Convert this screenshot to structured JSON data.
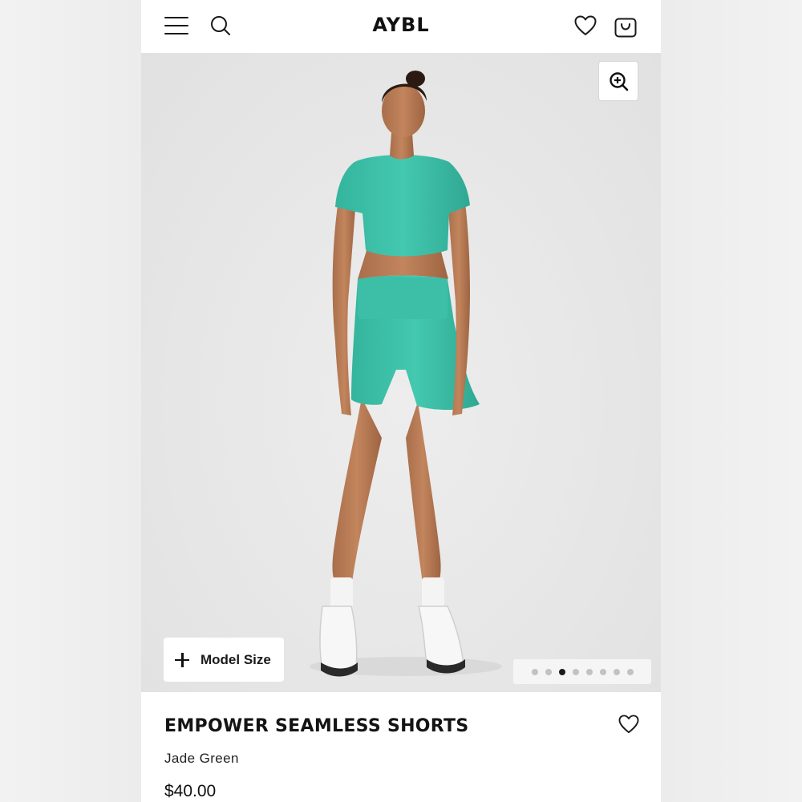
{
  "header": {
    "logo": "AYBL",
    "icons": [
      "menu-icon",
      "search-icon",
      "heart-icon",
      "bag-icon"
    ]
  },
  "gallery": {
    "model_size_label": "Model Size",
    "total_images": 8,
    "active_index": 2,
    "icons": [
      "zoom-in-icon",
      "plus-icon"
    ]
  },
  "product": {
    "title": "EMPOWER SEAMLESS SHORTS",
    "color": "Jade Green",
    "price": "$40.00"
  },
  "colors": {
    "accent_product": "#3cc3ab",
    "background": "#e6e6e6",
    "text": "#141414"
  }
}
